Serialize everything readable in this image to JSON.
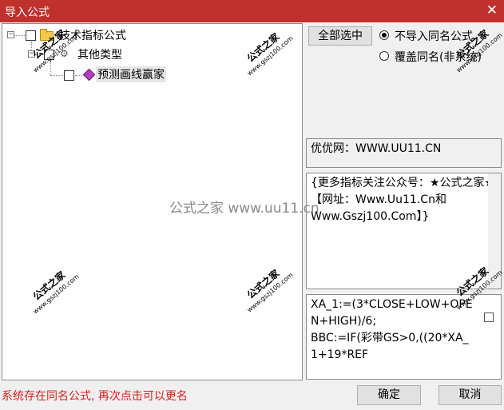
{
  "window": {
    "title": "导入公式",
    "close_glyph": "✕"
  },
  "tree": {
    "root": {
      "label": "技术指标公式",
      "expander": "⊟"
    },
    "group": {
      "label": "其他类型",
      "expander": "⊟"
    },
    "item": {
      "label": "预测画线赢家"
    }
  },
  "options": {
    "select_all_label": "全部选中",
    "radio_no_import": "不导入同名公式",
    "radio_overwrite": "覆盖同名(非系统)",
    "selected": "radio_no_import"
  },
  "site_text": "优优网：WWW.UU11.CN",
  "description_text": "{更多指标关注公众号：★公式之家★【网址：Www.Uu11.Cn和Www.Gszj100.Com】}",
  "code_text": "XA_1:=(3*CLOSE+LOW+OPEN+HIGH)/6;\nBBC:=IF(彩带GS>0,((20*XA_1+19*REF",
  "status_message": "系统存在同名公式, 再次点击可以更名",
  "buttons": {
    "ok_label": "确定",
    "cancel_label": "取消"
  },
  "watermarks": {
    "title": "公式之家",
    "url": "www.gszj100.com",
    "center_text": "公式之家 www.uu11.cn"
  },
  "colors": {
    "titlebar": "#c0302c",
    "status": "#d81e1e"
  }
}
